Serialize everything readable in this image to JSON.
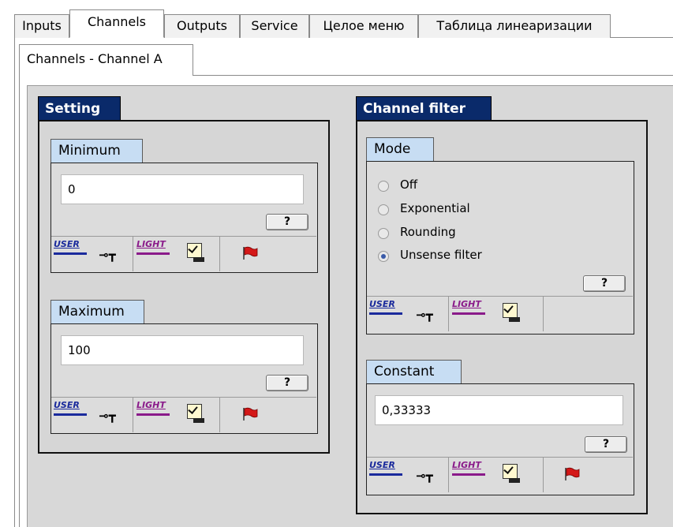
{
  "top_tabs": [
    "Inputs",
    "Channels",
    "Outputs",
    "Service",
    "Целое меню",
    "Таблица линеаризации"
  ],
  "active_top_tab": "Channels",
  "sub_tab": "Channels - Channel A",
  "setting": {
    "title": "Setting",
    "minimum": {
      "label": "Minimum",
      "value": "0",
      "help": "?"
    },
    "maximum": {
      "label": "Maximum",
      "value": "100",
      "help": "?"
    }
  },
  "filter": {
    "title": "Channel filter",
    "mode": {
      "label": "Mode",
      "options": [
        "Off",
        "Exponential",
        "Rounding",
        "Unsense filter"
      ],
      "selected": "Unsense filter",
      "help": "?"
    },
    "constant": {
      "label": "Constant",
      "value": "0,33333",
      "help": "?"
    }
  },
  "status": {
    "user": "USER",
    "light": "LIGHT",
    "key_icon": "key-icon",
    "check_icon": "checkbox-icon",
    "flag_icon": "flag-icon"
  },
  "colors": {
    "group_header": "#0a2a6a",
    "panel_header": "#c7ddf3",
    "panel_bg": "#d8d8d8"
  }
}
